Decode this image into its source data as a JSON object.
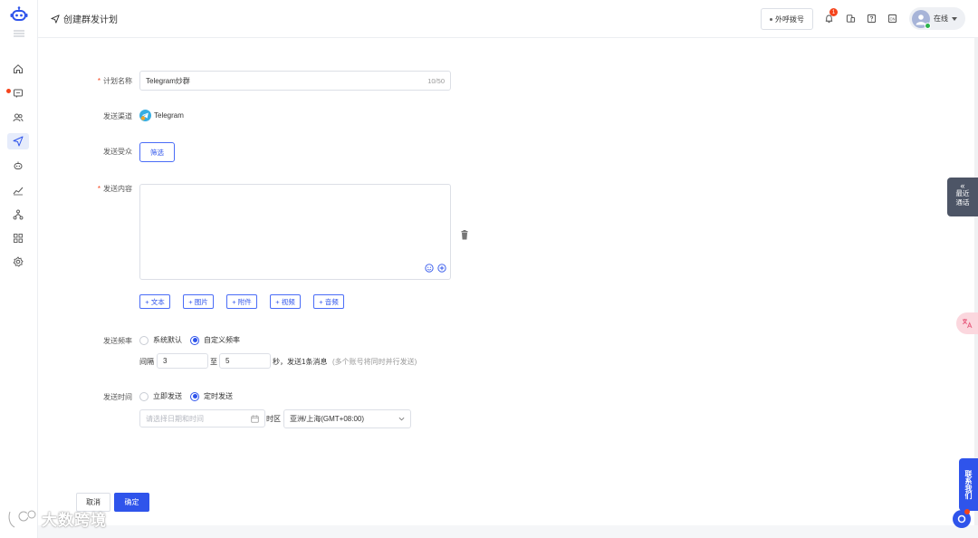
{
  "header": {
    "title": "创建群发计划",
    "call_button": "外呼拨号",
    "notification_count": "1",
    "status_label": "在线"
  },
  "form": {
    "plan_name": {
      "label": "计划名称",
      "value": "Telegram炒群",
      "counter": "10/50"
    },
    "channel": {
      "label": "发送渠道",
      "value": "Telegram"
    },
    "audience": {
      "label": "发送受众",
      "button": "筛选"
    },
    "content": {
      "label": "发送内容",
      "add_buttons": [
        "+ 文本",
        "+ 图片",
        "+ 附件",
        "+ 视频",
        "+ 音频"
      ]
    },
    "frequency": {
      "label": "发送频率",
      "options": [
        "系统默认",
        "自定义频率"
      ],
      "selected": "自定义频率",
      "interval_label": "间隔",
      "interval_from": "3",
      "to_label": "至",
      "interval_to": "5",
      "suffix": "秒，发送1条消息",
      "note": "(多个账号将同时并行发送)"
    },
    "send_time": {
      "label": "发送时间",
      "options": [
        "立即发送",
        "定时发送"
      ],
      "selected": "定时发送",
      "datetime_placeholder": "请选择日期和时间",
      "timezone_label": "时区",
      "timezone_value": "亚洲/上海(GMT+08:00)"
    },
    "cancel_label": "取消",
    "confirm_label": "确定"
  },
  "floating": {
    "recent_call_line1": "最近",
    "recent_call_line2": "通话",
    "contact_us": "联系我们"
  },
  "watermark": "大数跨境",
  "colors": {
    "primary": "#2f54eb",
    "required": "#f5441c",
    "online": "#2bb24c"
  }
}
